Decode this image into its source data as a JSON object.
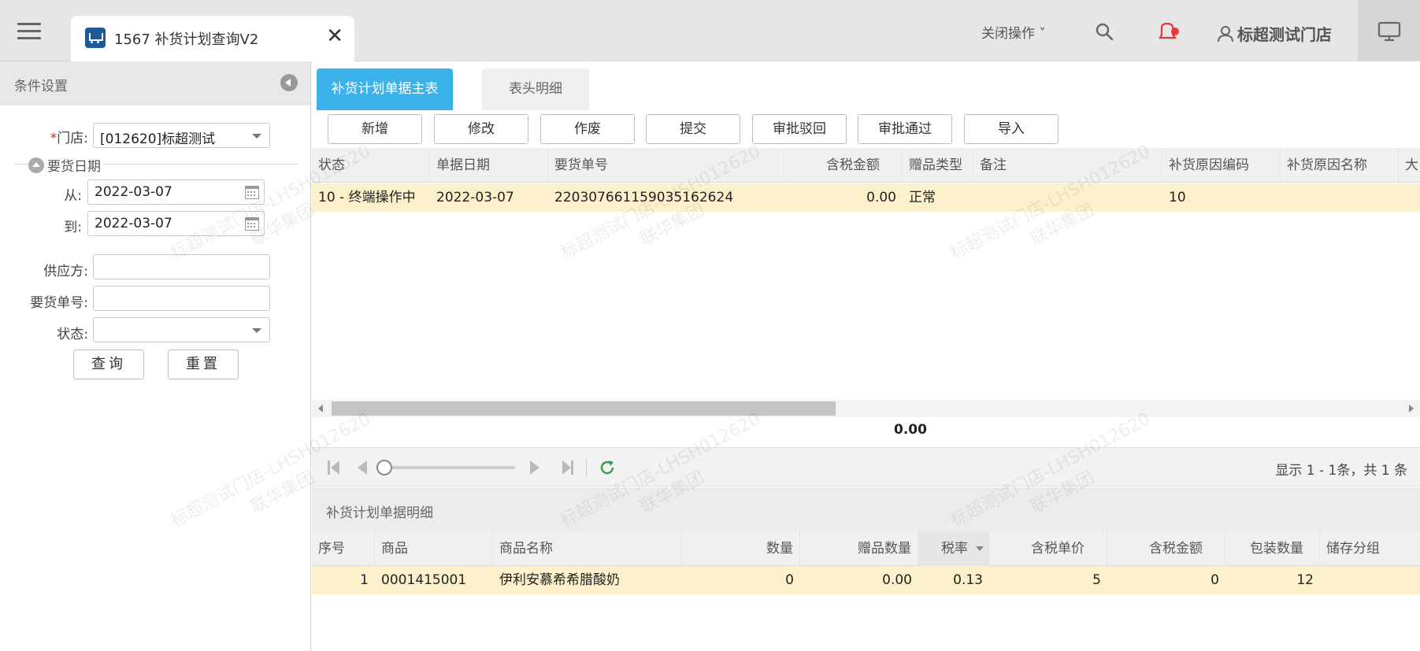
{
  "window": {
    "tab_title": "1567 补货计划查询V2",
    "tab_close": "✕",
    "close_ops_label": "关闭操作 ˅",
    "user_name": "标超测试门店"
  },
  "left_panel": {
    "title": "条件设置",
    "store_label": "门店:",
    "store_required": "*",
    "store_value": "[012620]标超测试",
    "date_group_label": "要货日期",
    "from_label": "从:",
    "from_value": "2022-03-07",
    "to_label": "到:",
    "to_value": "2022-03-07",
    "supplier_label": "供应方:",
    "supplier_value": "",
    "order_no_label": "要货单号:",
    "order_no_value": "",
    "status_label": "状态:",
    "status_value": "",
    "query_button": "查询",
    "reset_button": "重置"
  },
  "main": {
    "tabs": [
      {
        "label": "补货计划单据主表",
        "active": true
      },
      {
        "label": "表头明细",
        "active": false
      }
    ],
    "toolbar": {
      "add": "新增",
      "edit": "修改",
      "void": "作废",
      "submit": "提交",
      "reject": "审批驳回",
      "approve": "审批通过",
      "import": "导入"
    },
    "master_columns": [
      "状态",
      "单据日期",
      "要货单号",
      "含税金额",
      "赠品类型",
      "备注",
      "补货原因编码",
      "补货原因名称",
      "大"
    ],
    "master_rows": [
      [
        "10 - 终端操作中",
        "2022-03-07",
        "220307661159035162624",
        "0.00",
        "正常",
        "",
        "10",
        "",
        ""
      ]
    ],
    "total": "0.00",
    "pager_info": "显示 1 - 1条，共 1 条",
    "detail_title": "补货计划单据明细",
    "detail_columns": [
      "序号",
      "商品",
      "商品名称",
      "数量",
      "赠品数量",
      "税率",
      "含税单价",
      "含税金额",
      "包装数量",
      "储存分组"
    ],
    "detail_rows": [
      [
        "1",
        "0001415001",
        "伊利安慕希希腊酸奶",
        "0",
        "0.00",
        "0.13",
        "5",
        "0",
        "12",
        ""
      ]
    ]
  },
  "watermark": {
    "line1": "标超测试门店-LHSH012620",
    "line2": "联华集团"
  },
  "colors": {
    "accent": "#3bb3ea",
    "row_highlight": "#fdf1cc",
    "annotation_red": "#c21c1c"
  }
}
